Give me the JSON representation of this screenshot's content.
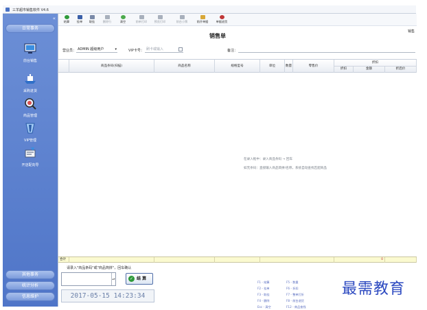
{
  "window": {
    "title": "三羊超市销售软件 V4.6"
  },
  "sidebar": {
    "top_button": "日常事务",
    "items": [
      {
        "label": "前台销售",
        "icon": "monitor-icon"
      },
      {
        "label": "采购进货",
        "icon": "ship-icon"
      },
      {
        "label": "商品管理",
        "icon": "magnifier-icon"
      },
      {
        "label": "VIP管理",
        "icon": "vip-card-icon"
      },
      {
        "label": "开店配向导",
        "icon": "wizard-icon"
      }
    ],
    "bottom_buttons": [
      "其他事务",
      "统计分析",
      "信息维护"
    ]
  },
  "toolbar": {
    "buttons": [
      {
        "label": "结算",
        "icon": "check-icon",
        "color": "#2e9a3a",
        "enabled": true
      },
      {
        "label": "挂单",
        "icon": "save-icon",
        "color": "#3a5fa8",
        "enabled": true
      },
      {
        "label": "取挂",
        "icon": "folder-icon",
        "color": "#7a8aa8",
        "enabled": true
      },
      {
        "label": "删除行",
        "icon": "delete-row-icon",
        "color": "#a8b0bc",
        "enabled": false
      },
      {
        "label": "清空",
        "icon": "clear-icon",
        "color": "#4caa4c",
        "enabled": true
      },
      {
        "label": "前单打印",
        "icon": "print-icon",
        "color": "#a8b0bc",
        "enabled": false
      },
      {
        "label": "预览打印",
        "icon": "preview-icon",
        "color": "#a8b0bc",
        "enabled": false
      },
      {
        "label": "前台小票",
        "icon": "ticket-icon",
        "color": "#a8b0bc",
        "enabled": false
      },
      {
        "label": "前开单据",
        "icon": "open-folder-icon",
        "color": "#d8a838",
        "enabled": true
      },
      {
        "label": "单据退货",
        "icon": "return-icon",
        "color": "#c03838",
        "enabled": true
      }
    ]
  },
  "header": {
    "doc_title": "销售单",
    "right_label": "销售",
    "cashier_label": "营业员：",
    "cashier_value": "ADMIN 超级用户",
    "vip_label": "VIP卡号：",
    "vip_placeholder": "刷卡或输入",
    "remark_label": "备注："
  },
  "grid": {
    "columns": [
      "商品条码(扫描)",
      "商品名称",
      "规格型号",
      "单位",
      "数量",
      "零售价"
    ],
    "group_label": "折扣",
    "sub_columns": [
      "折扣",
      "金额",
      "折后价"
    ],
    "empty_tips": [
      "在录入框中：录入商品条码 → 回车",
      "如无条码：直接输入商品简拼/名称，系统自动查找匹配商品"
    ],
    "total_label": "合计",
    "total_value": "0"
  },
  "bottom": {
    "hint": "请录入\"商品条码\"或\"商品简拼\"，回车确认",
    "checkout_label": "结 算",
    "datetime": "2017-05-15 14:23:34",
    "shortcuts": [
      "F1 - 结算",
      "F2 - 挂单",
      "F3 - 取挂",
      "F4 - 删除",
      "Esc - 清空",
      "F5 - 数量",
      "F6 - 折扣",
      "F7 - 整单打折",
      "F8 - 前台退货",
      "F12 - 商品查找"
    ]
  },
  "watermark": "最需教育"
}
